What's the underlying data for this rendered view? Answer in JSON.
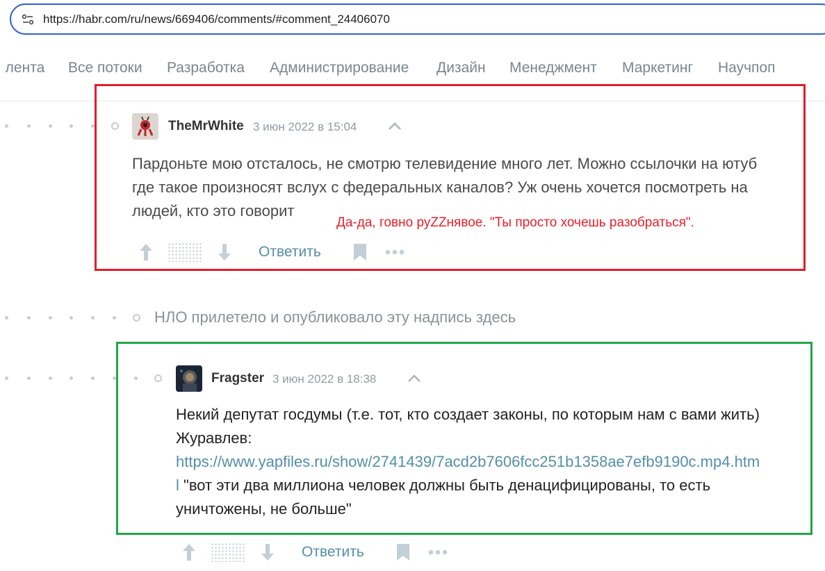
{
  "browser": {
    "url": "https://habr.com/ru/news/669406/comments/#comment_24406070"
  },
  "nav": {
    "items": [
      "ı лента",
      "Все потоки",
      "Разработка",
      "Администрирование",
      "Дизайн",
      "Менеджмент",
      "Маркетинг",
      "Научпоп"
    ]
  },
  "comment1": {
    "author": "TheMrWhite",
    "date": "3 июн 2022 в 15:04",
    "text_lines": [
      "Пардоньте мою отсталось, не смотрю телевидение много лет. Можно ссылочки на ютуб",
      "где такое произносят вслух с федеральных каналов? Уж очень хочется посмотреть на",
      "людей, кто это говорит"
    ],
    "annotation": "Да-да, говно руZZнявое. \"Ты просто хочешь разобраться\".",
    "reply_label": "Ответить"
  },
  "ufo_notice": "НЛО прилетело и опубликовало эту надпись здесь",
  "comment2": {
    "author": "Fragster",
    "date": "3 июн 2022 в 18:38",
    "line1": "Некий депутат госдумы (т.е. тот, кто создает законы, по которым нам с вами жить)",
    "line2": "Журавлев:",
    "link_part1": "https://www.yapfiles.ru/show/2741439/7acd2b7606fcc251b1358ae7efb9190c.mp4.htm",
    "link_part2": "l",
    "line4_rest": " \"вот эти два миллиона человек должны быть денацифицированы, то есть",
    "line5": "уничтожены, не больше\"",
    "reply_label": "Ответить"
  },
  "colors": {
    "annotation_red": "#e11d2a",
    "annotation_green": "#1fa64a",
    "link": "#548eaa"
  }
}
